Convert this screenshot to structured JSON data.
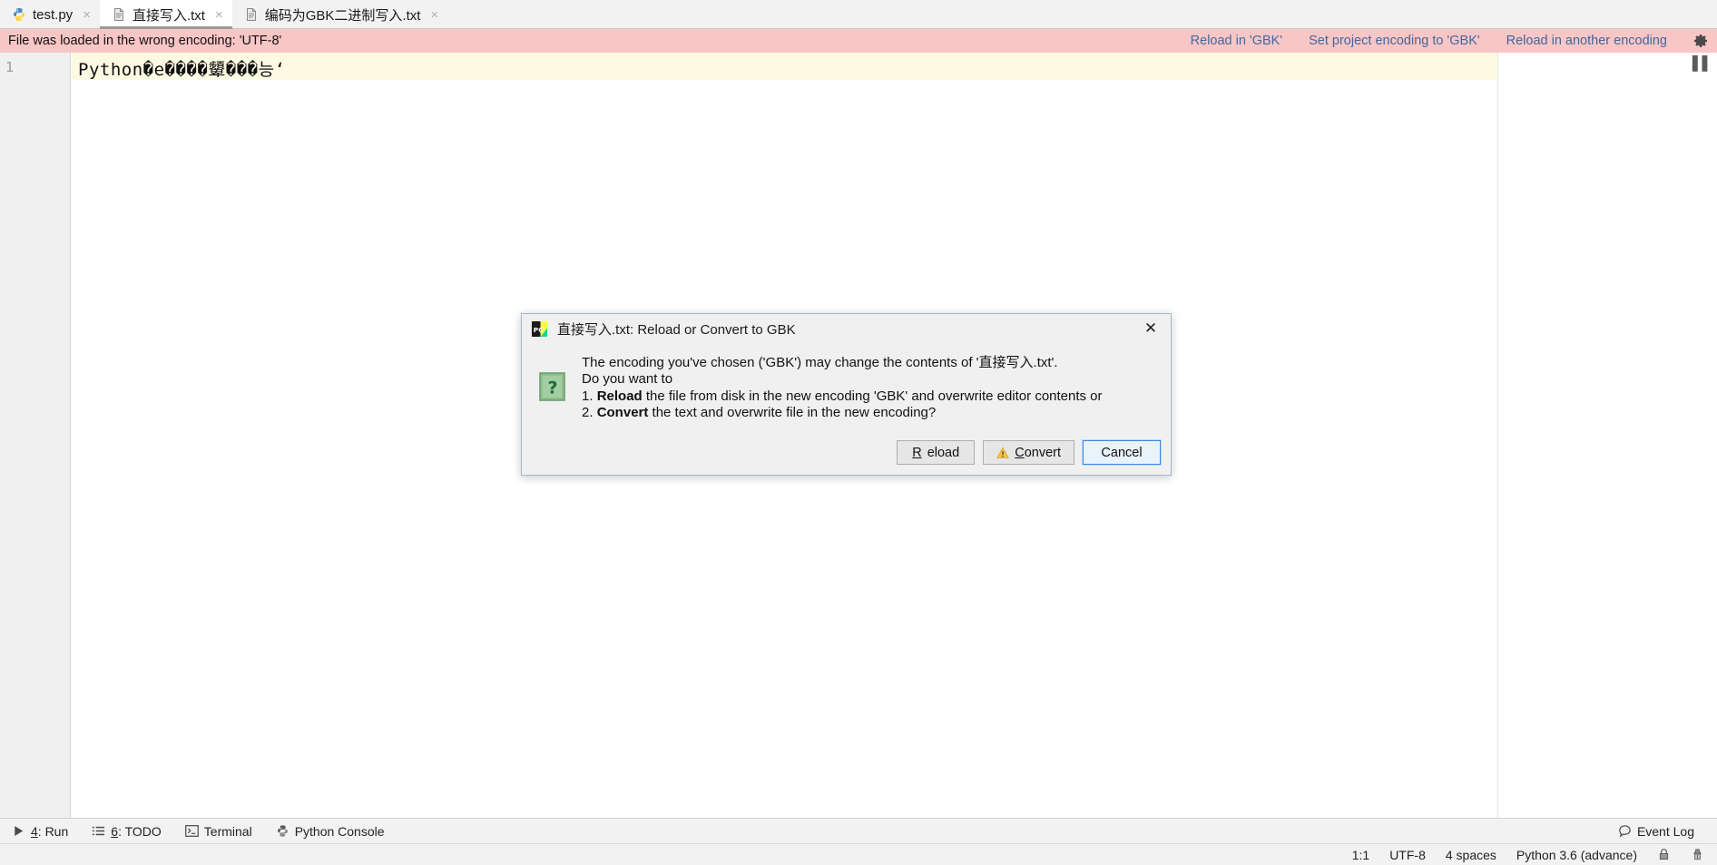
{
  "tabs": [
    {
      "label": "test.py",
      "icon": "python-file-icon",
      "active": false,
      "close": "×"
    },
    {
      "label": "直接写入.txt",
      "icon": "text-file-icon",
      "active": true,
      "close": "×"
    },
    {
      "label": "编码为GBK二进制写入.txt",
      "icon": "text-file-icon",
      "active": false,
      "close": "×"
    }
  ],
  "notification": {
    "message": "File was loaded in the wrong encoding: 'UTF-8'",
    "background_color": "#f9c6c6",
    "link_color": "#41689e",
    "actions": [
      "Reload in 'GBK'",
      "Set project encoding to 'GBK'",
      "Reload in another encoding"
    ],
    "settings_icon": "gear-icon"
  },
  "editor": {
    "line_numbers": [
      "1"
    ],
    "lines": [
      "Python�e����顰���능ʻ"
    ],
    "current_line_highlight_color": "#fdfae4",
    "scroll_marker_icon": "scrollbar-marker-icon"
  },
  "dialog": {
    "app_icon": "pycharm-icon",
    "title": "直接写入.txt: Reload or Convert to GBK",
    "close_label": "✕",
    "severity_icon": "question-icon",
    "text": {
      "line1": "The encoding you've chosen ('GBK') may change the contents of '直接写入.txt'.",
      "line2": "Do you want to",
      "line3_prefix": "1. ",
      "line3_bold": "Reload",
      "line3_rest": " the file from disk in the new encoding 'GBK' and overwrite editor contents or",
      "line4_prefix": "2. ",
      "line4_bold": "Convert",
      "line4_rest": " the text and overwrite file in the new encoding?"
    },
    "buttons": [
      {
        "label": "Reload",
        "mnemonic": "R",
        "icon": null,
        "focused": false
      },
      {
        "label": "Convert",
        "mnemonic": "C",
        "icon": "warning-icon",
        "focused": false
      },
      {
        "label": "Cancel",
        "mnemonic": null,
        "icon": null,
        "focused": true
      }
    ]
  },
  "toolbar": {
    "items": [
      {
        "label": "4: Run",
        "mnemonic": "4",
        "icon": "run-icon"
      },
      {
        "label": "6: TODO",
        "mnemonic": "6",
        "icon": "todo-list-icon"
      },
      {
        "label": "Terminal",
        "mnemonic": null,
        "icon": "terminal-icon"
      },
      {
        "label": "Python Console",
        "mnemonic": null,
        "icon": "python-console-icon"
      }
    ],
    "event_log": {
      "label": "Event Log",
      "icon": "event-log-icon"
    }
  },
  "status_bar": {
    "caret_position": "1:1",
    "encoding": "UTF-8",
    "indent": "4 spaces",
    "interpreter": "Python 3.6 (advance)",
    "lock_icon": "lock-icon",
    "inspection_icon": "inspection-icon"
  }
}
